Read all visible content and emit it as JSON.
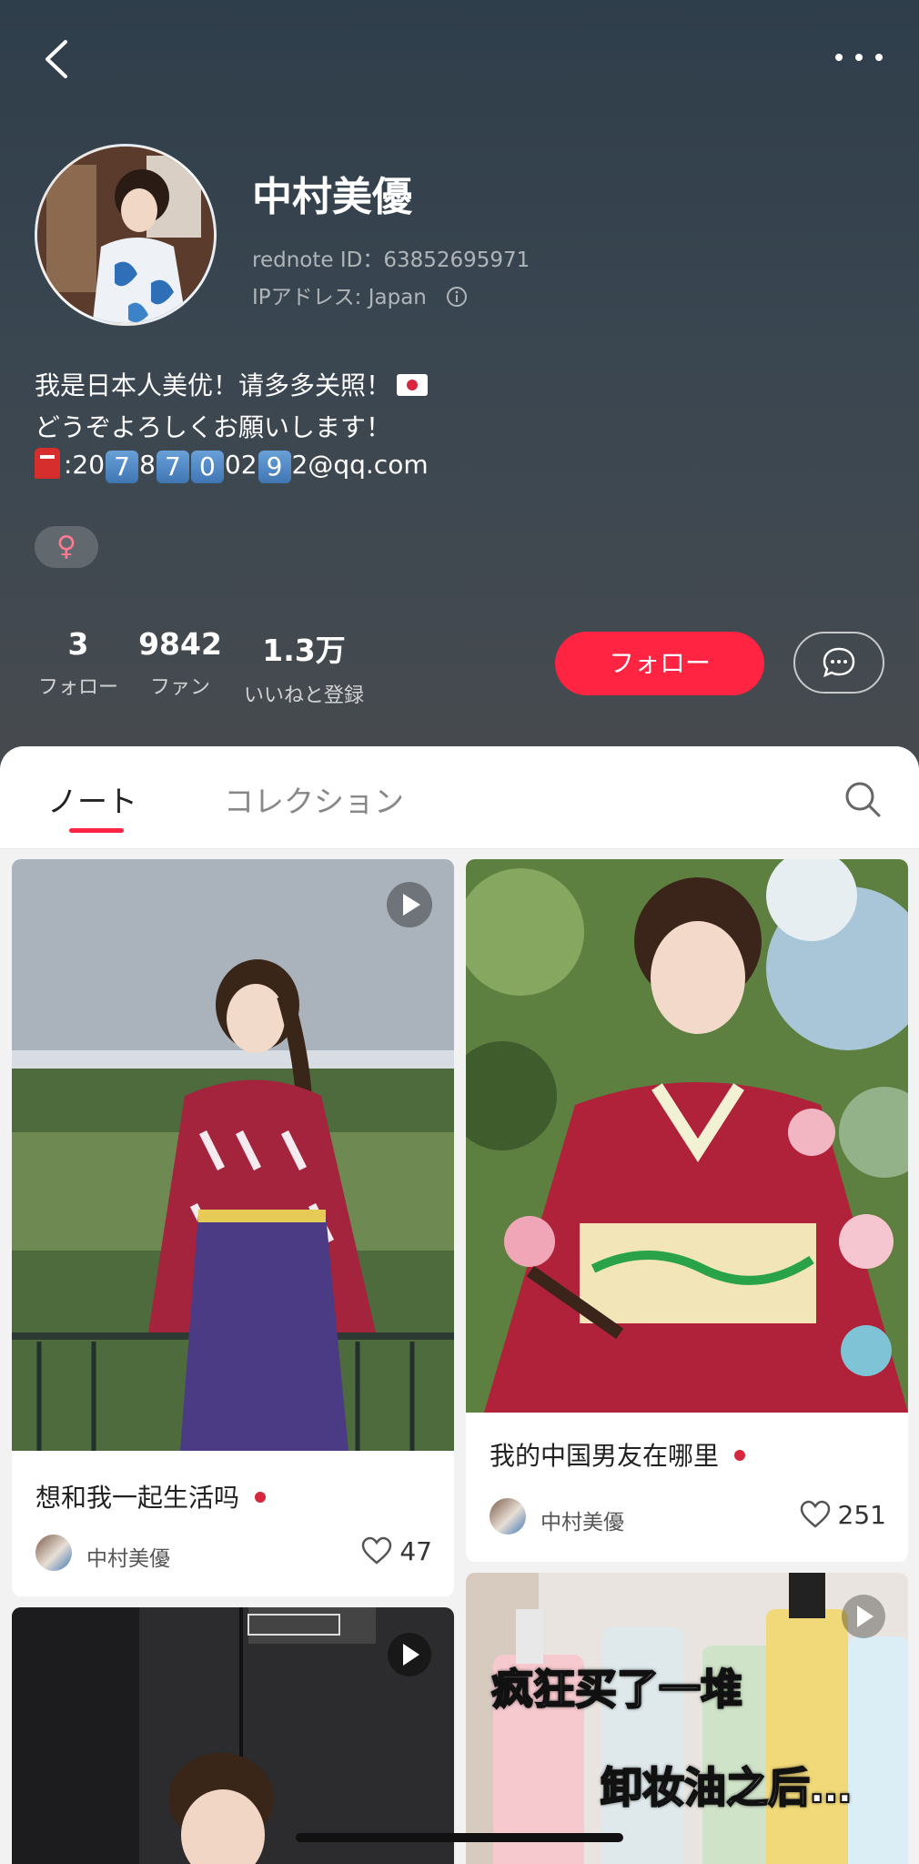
{
  "nav": {
    "back_icon": "chevron-left-icon",
    "more_icon": "more-dots-icon"
  },
  "profile": {
    "name": "中村美優",
    "rednote_id": "rednote ID：63852695971",
    "ip_label": "IPアドレス: Japan",
    "bio_line1": "我是日本人美优！请多多关照！",
    "bio_line2": "どうぞよろしくお願いします！",
    "email_parts": [
      ":20",
      "7",
      "8",
      "7",
      "0",
      "02",
      "9",
      "2@qq.com"
    ],
    "gender_symbol": "♀"
  },
  "stats": [
    {
      "value": "3",
      "label": "フォロー"
    },
    {
      "value": "9842",
      "label": "ファン"
    },
    {
      "value": "1.3万",
      "label": "いいねと登録"
    }
  ],
  "actions": {
    "follow_label": "フォロー"
  },
  "tabs": {
    "notes": "ノート",
    "collection": "コレクション"
  },
  "cards": [
    {
      "title": "想和我一起生活吗",
      "author": "中村美優",
      "likes": "47"
    },
    {
      "title": "我的中国男友在哪里",
      "author": "中村美優",
      "likes": "251"
    },
    {
      "overlay_line1": "疯狂买了一堆",
      "overlay_line2": "卸妆油之后…"
    }
  ],
  "colors": {
    "accent": "#ff2442",
    "header_top": "#2f3e4b",
    "header_bottom": "#474b4f"
  }
}
